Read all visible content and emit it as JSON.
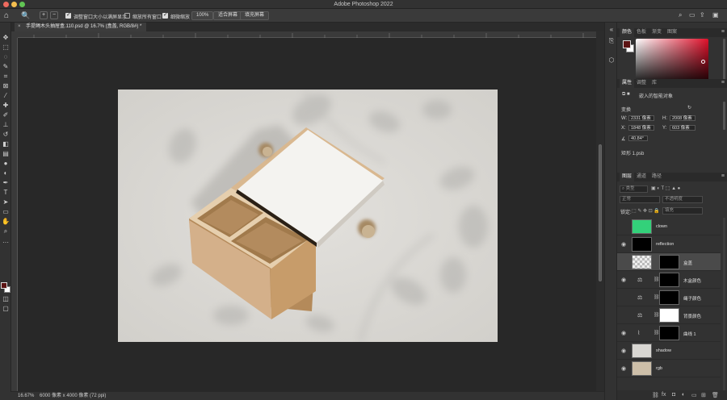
{
  "app": {
    "title": "Adobe Photoshop 2022"
  },
  "options": {
    "zoom_tool": "🔍",
    "check1": "调整窗口大小以满屏显示",
    "check2": "缩放所有窗口",
    "check3": "细微缩放",
    "zoom_value": "100%",
    "fit_screen": "适合屏幕",
    "fill_screen": "填充屏幕"
  },
  "document": {
    "tab_title": "手提绳木头抽屉盒.110.psd @ 16.7% (盒盖, RGB/8#) *"
  },
  "status": {
    "zoom": "16.67%",
    "dims": "6000 像素 x 4000 像素 (72 ppi)"
  },
  "color_panel": {
    "tabs": [
      "颜色",
      "色板",
      "渐变",
      "图案"
    ]
  },
  "props_panel": {
    "tabs": [
      "属性",
      "调整",
      "库"
    ],
    "object_type": "嵌入的智能对象",
    "section": "变换",
    "w_label": "W:",
    "w_value": "2331 像素",
    "h_label": "H:",
    "h_value": "2008 像素",
    "x_label": "X:",
    "x_value": "1848 像素",
    "y_label": "Y:",
    "y_value": "603 像素",
    "angle": "40.84°",
    "file": "矩形 1.psb"
  },
  "layers_panel": {
    "tabs": [
      "图层",
      "通道",
      "路径"
    ],
    "filter": "类型",
    "blend": "正常",
    "opacity": "不透明度",
    "lock": "锁定:",
    "fill": "填充",
    "layers": [
      {
        "name": "clown",
        "visible": false,
        "kind": "clown"
      },
      {
        "name": "reflection",
        "visible": true,
        "kind": "black"
      },
      {
        "name": "盒盖",
        "visible": false,
        "kind": "smart",
        "selected": true
      },
      {
        "name": "木盒颜色",
        "visible": true,
        "kind": "adjust"
      },
      {
        "name": "绳子颜色",
        "visible": false,
        "kind": "adjust"
      },
      {
        "name": "背景颜色",
        "visible": false,
        "kind": "adjust"
      },
      {
        "name": "曲线 1",
        "visible": true,
        "kind": "curves"
      },
      {
        "name": "shadow",
        "visible": true,
        "kind": "photo"
      },
      {
        "name": "rgb",
        "visible": true,
        "kind": "photo2"
      }
    ]
  },
  "colors": {
    "foreground": "#5c1414",
    "background": "#ffffff",
    "clown_thumb": "#33d17a"
  }
}
